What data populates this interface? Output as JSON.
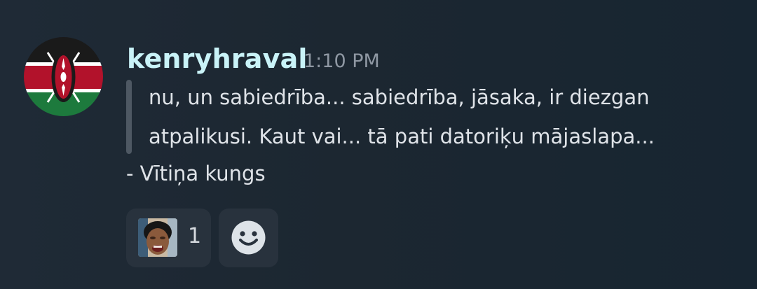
{
  "message": {
    "author": "kenryhraval",
    "timestamp": "1:10 PM",
    "avatar_icon": "kenya-flag-icon",
    "quote_lines": [
      "nu, un sabiedrība... sabiedrība, jāsaka, ir diezgan",
      "atpalikusi. Kaut vai... tā pati datoriķu mājaslapa..."
    ],
    "attribution": "- Vītiņa kungs"
  },
  "reactions": [
    {
      "emoji_icon": "crying-face-custom-emoji-icon",
      "count": "1"
    }
  ],
  "add_reaction_icon": "smiley-add-reaction-icon",
  "colors": {
    "username": "#c9f3f8",
    "text": "#dfe3e8",
    "timestamp": "#8f98a3",
    "pill_background": "#28323d",
    "quote_bar": "#4e5863"
  }
}
